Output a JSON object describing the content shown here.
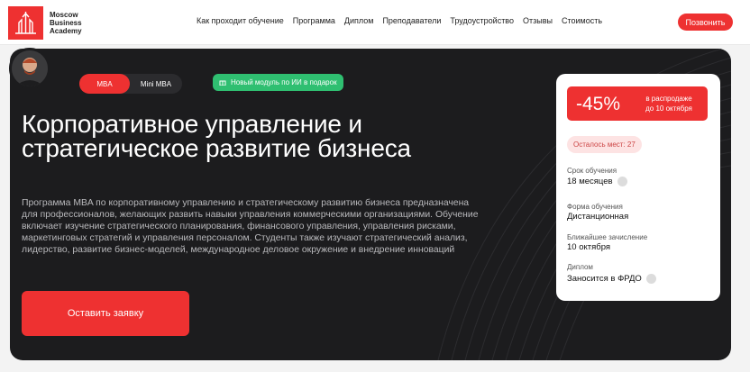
{
  "header": {
    "logo_line1": "Moscow",
    "logo_line2": "Business",
    "logo_line3": "Academy",
    "nav": [
      "Как проходит обучение",
      "Программа",
      "Диплом",
      "Преподаватели",
      "Трудоустройство",
      "Отзывы",
      "Стоимость"
    ],
    "call_button": "Позвонить"
  },
  "hero": {
    "tabs": [
      "MBA",
      "Mini MBA"
    ],
    "ai_badge": "Новый модуль по ИИ в подарок",
    "title": "Корпоративное управление и стратегическое развитие бизнеса",
    "description": "Программа MBA по корпоративному управлению и стратегическому развитию бизнеса предназначена для профессионалов, желающих развить навыки управления коммерческими организациями. Обучение включает изучение стратегического планирования, финансового управления, управления рисками, маркетинговых стратегий и управления персоналом. Студенты также изучают стратегический анализ, лидерство, развитие бизнес-моделей, международное деловое окружение и внедрение инноваций",
    "apply_button": "Оставить заявку"
  },
  "card": {
    "discount": "-45%",
    "discount_note_1": "в распродаже",
    "discount_note_2": "до 10 октября",
    "seats_left": "Осталось мест: 27",
    "duration_label": "Срок обучения",
    "duration_value": "18 месяцев",
    "format_label": "Форма обучения",
    "format_value": "Дистанционная",
    "enrollment_label": "Ближайшее зачисление",
    "enrollment_value": "10 октября",
    "diploma_label": "Диплом",
    "diploma_value": "Заносится в ФРДО"
  },
  "colors": {
    "accent": "#ee3131",
    "dark": "#1c1c1e",
    "green": "#2fbf71"
  }
}
